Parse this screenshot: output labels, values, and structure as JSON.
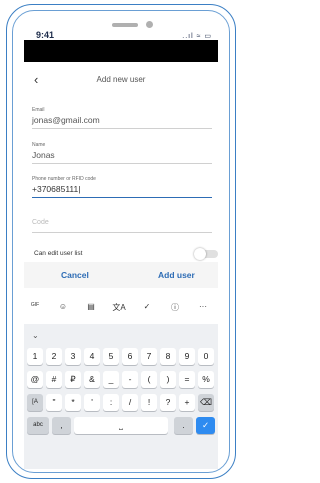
{
  "status": {
    "time": "9:41",
    "signal": "..ıl ≈ ▭"
  },
  "header": {
    "back_icon": "‹",
    "title": "Add new user"
  },
  "form": {
    "email": {
      "label": "Email",
      "value": "jonas@gmail.com"
    },
    "name": {
      "label": "Name",
      "value": "Jonas"
    },
    "phone": {
      "label": "Phone number or RFID code",
      "value": "+370685111|"
    },
    "code": {
      "placeholder": "Code"
    },
    "can_edit": {
      "label": "Can edit user list",
      "enabled": false
    }
  },
  "actions": {
    "cancel": "Cancel",
    "add": "Add user"
  },
  "toolbar": [
    {
      "glyph": "GIF",
      "name": "gif-icon"
    },
    {
      "glyph": "☺",
      "name": "sticker-icon"
    },
    {
      "glyph": "▤",
      "name": "clipboard-icon"
    },
    {
      "glyph": "文A",
      "name": "translate-icon"
    },
    {
      "glyph": "✓",
      "name": "spellcheck-icon"
    },
    {
      "glyph": "ⓘ",
      "name": "info-icon"
    },
    {
      "glyph": "···",
      "name": "more-icon"
    }
  ],
  "hide_icon": "⌄",
  "keys": {
    "row1": [
      "1",
      "2",
      "3",
      "4",
      "5",
      "6",
      "7",
      "8",
      "9",
      "0"
    ],
    "row2": [
      "@",
      "#",
      "₽",
      "&",
      "_",
      "-",
      "(",
      ")",
      "=",
      "%"
    ],
    "row3": [
      "[A",
      "\"",
      "*",
      "'",
      ":",
      "/",
      "!",
      "?",
      "+"
    ],
    "row3_del": "⌫",
    "row4": {
      "abc": "abc",
      "comma": ",",
      "space": "⎵",
      "period": ".",
      "done": "✓"
    }
  }
}
